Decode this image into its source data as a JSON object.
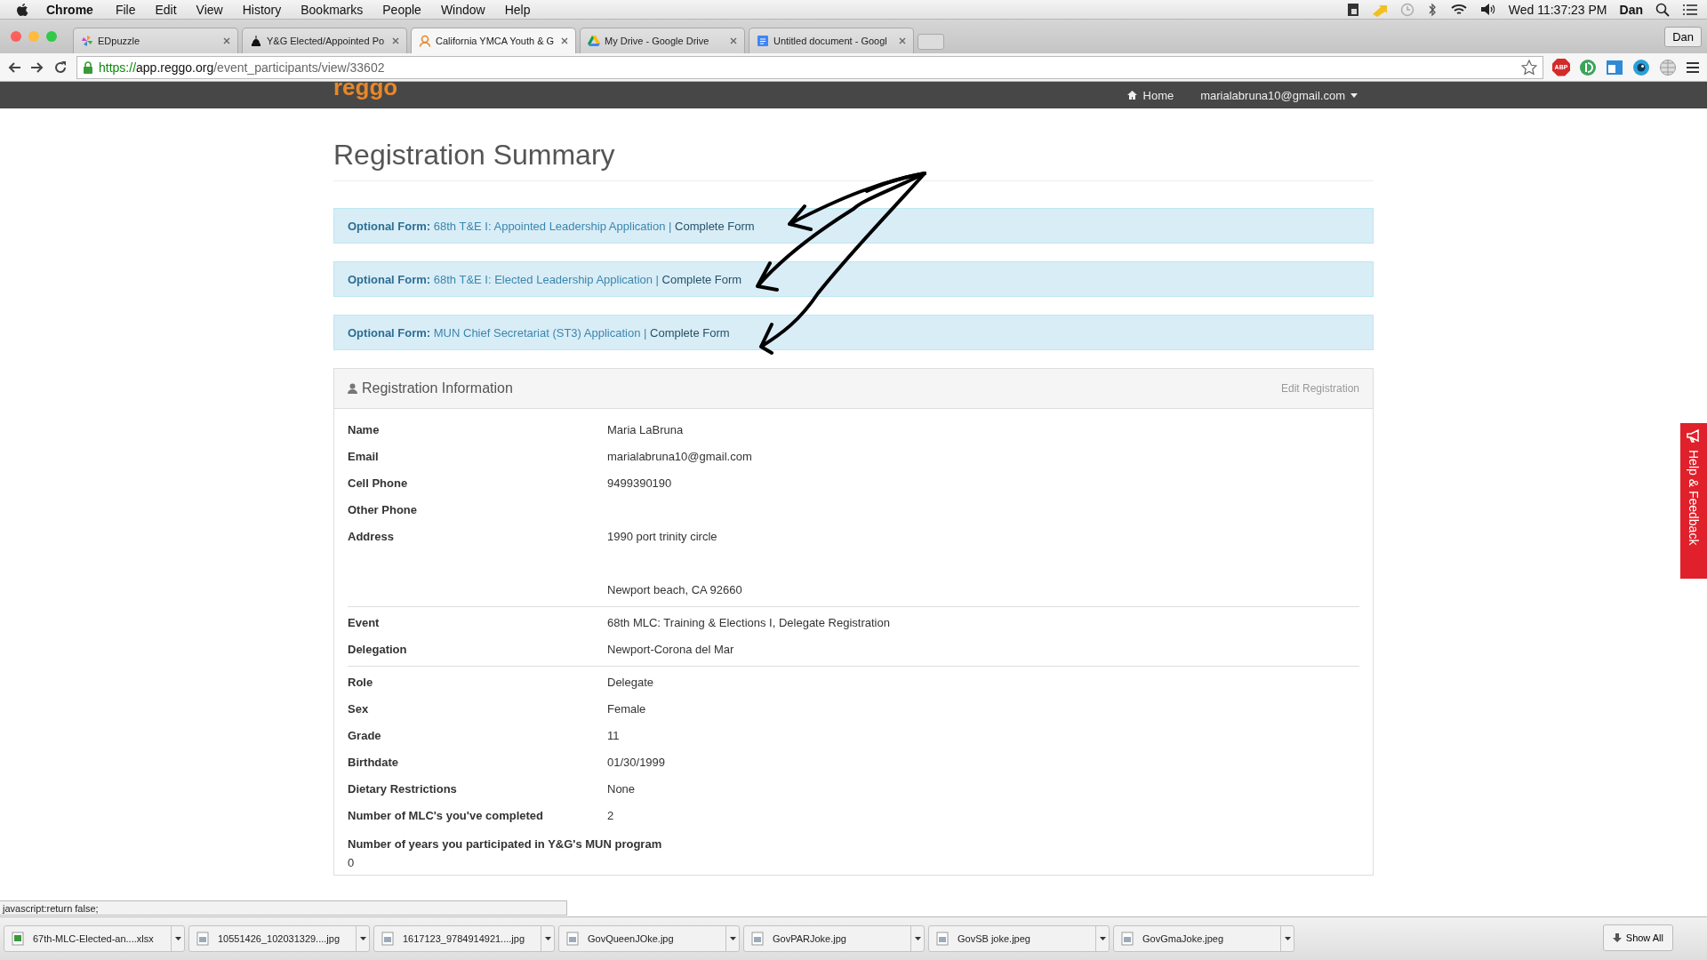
{
  "menu_bar": {
    "app": "Chrome",
    "items": [
      "File",
      "Edit",
      "View",
      "History",
      "Bookmarks",
      "People",
      "Window",
      "Help"
    ],
    "clock": "Wed 11:37:23 PM",
    "user": "Dan"
  },
  "tabs": [
    {
      "title": "EDpuzzle",
      "selected": false
    },
    {
      "title": "Y&G Elected/Appointed Po",
      "selected": false
    },
    {
      "title": "California YMCA Youth & G",
      "selected": true
    },
    {
      "title": "My Drive - Google Drive",
      "selected": false
    },
    {
      "title": "Untitled document - Googl",
      "selected": false
    }
  ],
  "profile_button": "Dan",
  "address_bar": {
    "scheme": "https://",
    "host": "app.reggo.org",
    "path": "/event_participants/view/33602"
  },
  "extensions": {
    "adblock_label": "ABP"
  },
  "site_nav": {
    "logo": "reggo",
    "home": "Home",
    "account": "marialabruna10@gmail.com"
  },
  "page_title": "Registration Summary",
  "forms": [
    {
      "text": "**Optional Form:** 68th T&E I: Appointed Leadership Application |",
      "link": "Complete Form"
    },
    {
      "text": "**Optional Form:** 68th T&E I: Elected Leadership Application |",
      "link": "Complete Form"
    },
    {
      "text": "**Optional Form:** MUN Chief Secretariat (ST3) Application |",
      "link": "Complete Form"
    }
  ],
  "panel": {
    "title": "Registration Information",
    "edit_link": "Edit Registration",
    "sections": [
      [
        {
          "kind": "inline",
          "label": "Name",
          "value": [
            "Maria LaBruna"
          ]
        },
        {
          "kind": "inline",
          "label": "Email",
          "value": [
            "marialabruna10@gmail.com"
          ]
        },
        {
          "kind": "inline",
          "label": "Cell Phone",
          "value": [
            "9499390190"
          ]
        },
        {
          "kind": "inline",
          "label": "Other Phone"
        },
        {
          "kind": "address",
          "label": "Address",
          "value": [
            "1990 port trinity circle",
            "Newport beach, CA 92660"
          ]
        }
      ],
      [
        {
          "kind": "inline",
          "label": "Event",
          "value": [
            "68th MLC: Training & Elections I, Delegate Registration"
          ]
        },
        {
          "kind": "inline",
          "label": "Delegation",
          "value": [
            "Newport-Corona del Mar"
          ]
        }
      ],
      [
        {
          "kind": "inline",
          "label": "Role",
          "value": [
            "Delegate"
          ]
        },
        {
          "kind": "inline",
          "label": "Sex",
          "value": [
            "Female"
          ]
        },
        {
          "kind": "inline",
          "label": "Grade",
          "value": [
            "11"
          ]
        },
        {
          "kind": "inline",
          "label": "Birthdate",
          "value": [
            "01/30/1999"
          ]
        },
        {
          "kind": "inline",
          "label": "Dietary Restrictions",
          "value": [
            "None"
          ]
        },
        {
          "kind": "inline",
          "label": "Number of MLC's you've completed",
          "value": [
            "2"
          ]
        },
        {
          "kind": "stacked",
          "label": "Number of years you participated in Y&G's MUN program",
          "value": [
            "0"
          ]
        }
      ]
    ]
  },
  "help_tab": "Help & Feedback",
  "status_text": "javascript:return false;",
  "downloads": [
    {
      "name": "67th-MLC-Elected-an....xlsx",
      "kind": "spreadsheet"
    },
    {
      "name": "10551426_102031329....jpg",
      "kind": "image"
    },
    {
      "name": "1617123_9784914921....jpg",
      "kind": "image"
    },
    {
      "name": "GovQueenJOke.jpg",
      "kind": "image"
    },
    {
      "name": "GovPARJoke.jpg",
      "kind": "image"
    },
    {
      "name": "GovSB joke.jpeg",
      "kind": "image"
    },
    {
      "name": "GovGmaJoke.jpeg",
      "kind": "image"
    }
  ],
  "show_all": "Show All"
}
